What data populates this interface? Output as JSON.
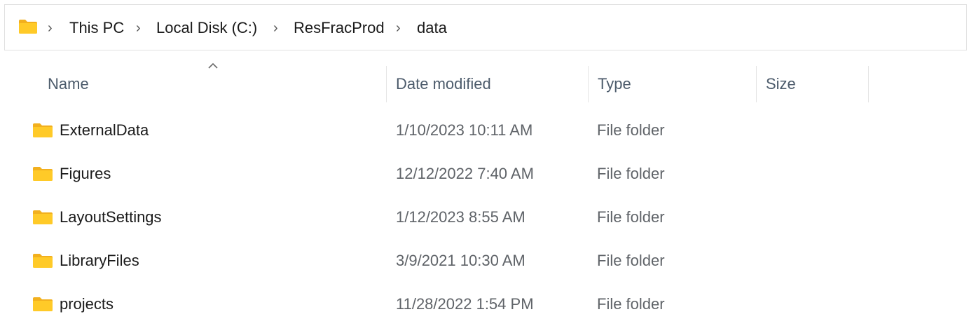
{
  "breadcrumb": {
    "icon": "folder-icon",
    "items": [
      "This PC",
      "Local Disk (C:)",
      "ResFracProd",
      "data"
    ],
    "separator": ">"
  },
  "columns": {
    "name": "Name",
    "date_modified": "Date modified",
    "type": "Type",
    "size": "Size",
    "sort": "Name ascending"
  },
  "rows": [
    {
      "name": "ExternalData",
      "date": "1/10/2023 10:11 AM",
      "type": "File folder",
      "size": ""
    },
    {
      "name": "Figures",
      "date": "12/12/2022 7:40 AM",
      "type": "File folder",
      "size": ""
    },
    {
      "name": "LayoutSettings",
      "date": "1/12/2023 8:55 AM",
      "type": "File folder",
      "size": ""
    },
    {
      "name": "LibraryFiles",
      "date": "3/9/2021 10:30 AM",
      "type": "File folder",
      "size": ""
    },
    {
      "name": "projects",
      "date": "11/28/2022 1:54 PM",
      "type": "File folder",
      "size": ""
    }
  ],
  "colors": {
    "folder_front": "#FFCA28",
    "folder_back": "#F2B01E",
    "header_text": "#4c5b6b",
    "secondary_text": "#5f6368"
  }
}
